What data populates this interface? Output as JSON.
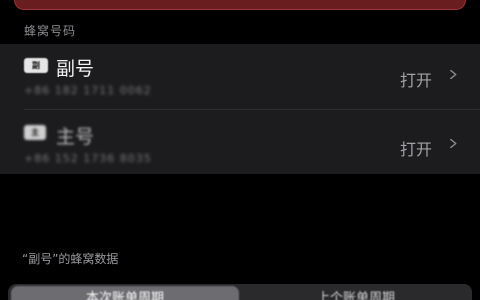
{
  "section_header": "蜂窝号码",
  "lines": [
    {
      "badge": "副",
      "title": "副号",
      "number": "+86 182 1711 0062",
      "action": "打开"
    },
    {
      "badge": "主",
      "title": "主号",
      "number": "+86 152 1736 8035",
      "action": "打开"
    }
  ],
  "data_usage_label": "“副号”的蜂窝数据",
  "tabs": {
    "current": "本次账单周期",
    "previous": "上个账单周期"
  },
  "icons": {
    "row_chevron": "chevron-right-icon",
    "sim_badge": "sim-card-icon"
  },
  "colors": {
    "background": "#000000",
    "card": "#1c1c1e",
    "secondary_text": "#8d8d92",
    "banner": "#6a1d1f"
  }
}
